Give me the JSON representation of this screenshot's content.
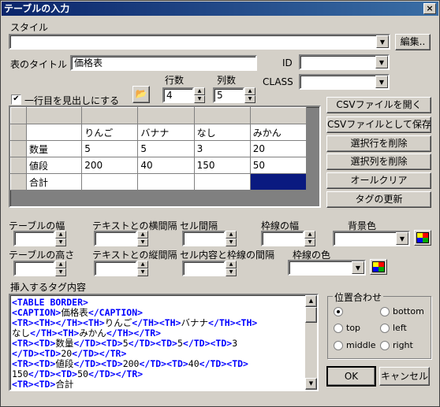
{
  "window": {
    "title": "テーブルの入力",
    "close": "×"
  },
  "style": {
    "label": "スタイル",
    "value": "",
    "edit_button": "編集.."
  },
  "title_field": {
    "label": "表のタイトル",
    "value": "価格表"
  },
  "id_field": {
    "label": "ID",
    "value": ""
  },
  "class_field": {
    "label": "CLASS",
    "value": ""
  },
  "header_check": {
    "label": "一行目を見出しにする",
    "checked": true
  },
  "rows": {
    "label": "行数",
    "value": "4"
  },
  "cols": {
    "label": "列数",
    "value": "5"
  },
  "grid": {
    "rows": [
      [
        "",
        "",
        "",
        "",
        ""
      ],
      [
        "",
        "りんご",
        "バナナ",
        "なし",
        "みかん"
      ],
      [
        "数量",
        "5",
        "5",
        "3",
        "20"
      ],
      [
        "値段",
        "200",
        "40",
        "150",
        "50"
      ],
      [
        "合計",
        "",
        "",
        "",
        ""
      ]
    ]
  },
  "actions": {
    "open_csv": "CSVファイルを開く",
    "save_csv": "CSVファイルとして保存",
    "delete_row": "選択行を削除",
    "delete_col": "選択列を削除",
    "clear_all": "オールクリア",
    "update_tags": "タグの更新"
  },
  "props": {
    "table_width": "テーブルの幅",
    "text_hspace": "テキストとの横間隔",
    "cell_spacing": "セル間隔",
    "border_width": "枠線の幅",
    "bg_color": "背景色",
    "table_height": "テーブルの高さ",
    "text_vspace": "テキストとの縦間隔",
    "cell_padding": "セル内容と枠線の間隔",
    "border_color": "枠線の色"
  },
  "insert": {
    "label": "挿入するタグ内容",
    "lines": [
      [
        [
          "t",
          "<TABLE BORDER>"
        ]
      ],
      [
        [
          "t",
          "<CAPTION>"
        ],
        [
          "x",
          "価格表"
        ],
        [
          "t",
          "</CAPTION>"
        ]
      ],
      [
        [
          "t",
          "<TR><TH></TH><TH>"
        ],
        [
          "x",
          "りんご"
        ],
        [
          "t",
          "</TH><TH>"
        ],
        [
          "x",
          "バナナ"
        ],
        [
          "t",
          "</TH><TH>"
        ]
      ],
      [
        [
          "x",
          "なし"
        ],
        [
          "t",
          "</TH><TH>"
        ],
        [
          "x",
          "みかん"
        ],
        [
          "t",
          "</TH></TR>"
        ]
      ],
      [
        [
          "t",
          "<TR><TD>"
        ],
        [
          "x",
          "数量"
        ],
        [
          "t",
          "</TD><TD>"
        ],
        [
          "x",
          "5"
        ],
        [
          "t",
          "</TD><TD>"
        ],
        [
          "x",
          "5"
        ],
        [
          "t",
          "</TD><TD>"
        ],
        [
          "x",
          "3"
        ]
      ],
      [
        [
          "t",
          "</TD><TD>"
        ],
        [
          "x",
          "20"
        ],
        [
          "t",
          "</TD></TR>"
        ]
      ],
      [
        [
          "t",
          "<TR><TD>"
        ],
        [
          "x",
          "値段"
        ],
        [
          "t",
          "</TD><TD>"
        ],
        [
          "x",
          "200"
        ],
        [
          "t",
          "</TD><TD>"
        ],
        [
          "x",
          "40"
        ],
        [
          "t",
          "</TD><TD>"
        ]
      ],
      [
        [
          "x",
          "150"
        ],
        [
          "t",
          "</TD><TD>"
        ],
        [
          "x",
          "50"
        ],
        [
          "t",
          "</TD></TR>"
        ]
      ],
      [
        [
          "t",
          "<TR><TD>"
        ],
        [
          "x",
          "合計"
        ]
      ]
    ]
  },
  "align": {
    "label": "位置合わせ",
    "options": [
      {
        "label": "",
        "selected": true
      },
      {
        "label": "bottom",
        "selected": false
      },
      {
        "label": "top",
        "selected": false
      },
      {
        "label": "left",
        "selected": false
      },
      {
        "label": "middle",
        "selected": false
      },
      {
        "label": "right",
        "selected": false
      }
    ]
  },
  "footer": {
    "ok": "OK",
    "cancel": "キャンセル"
  }
}
